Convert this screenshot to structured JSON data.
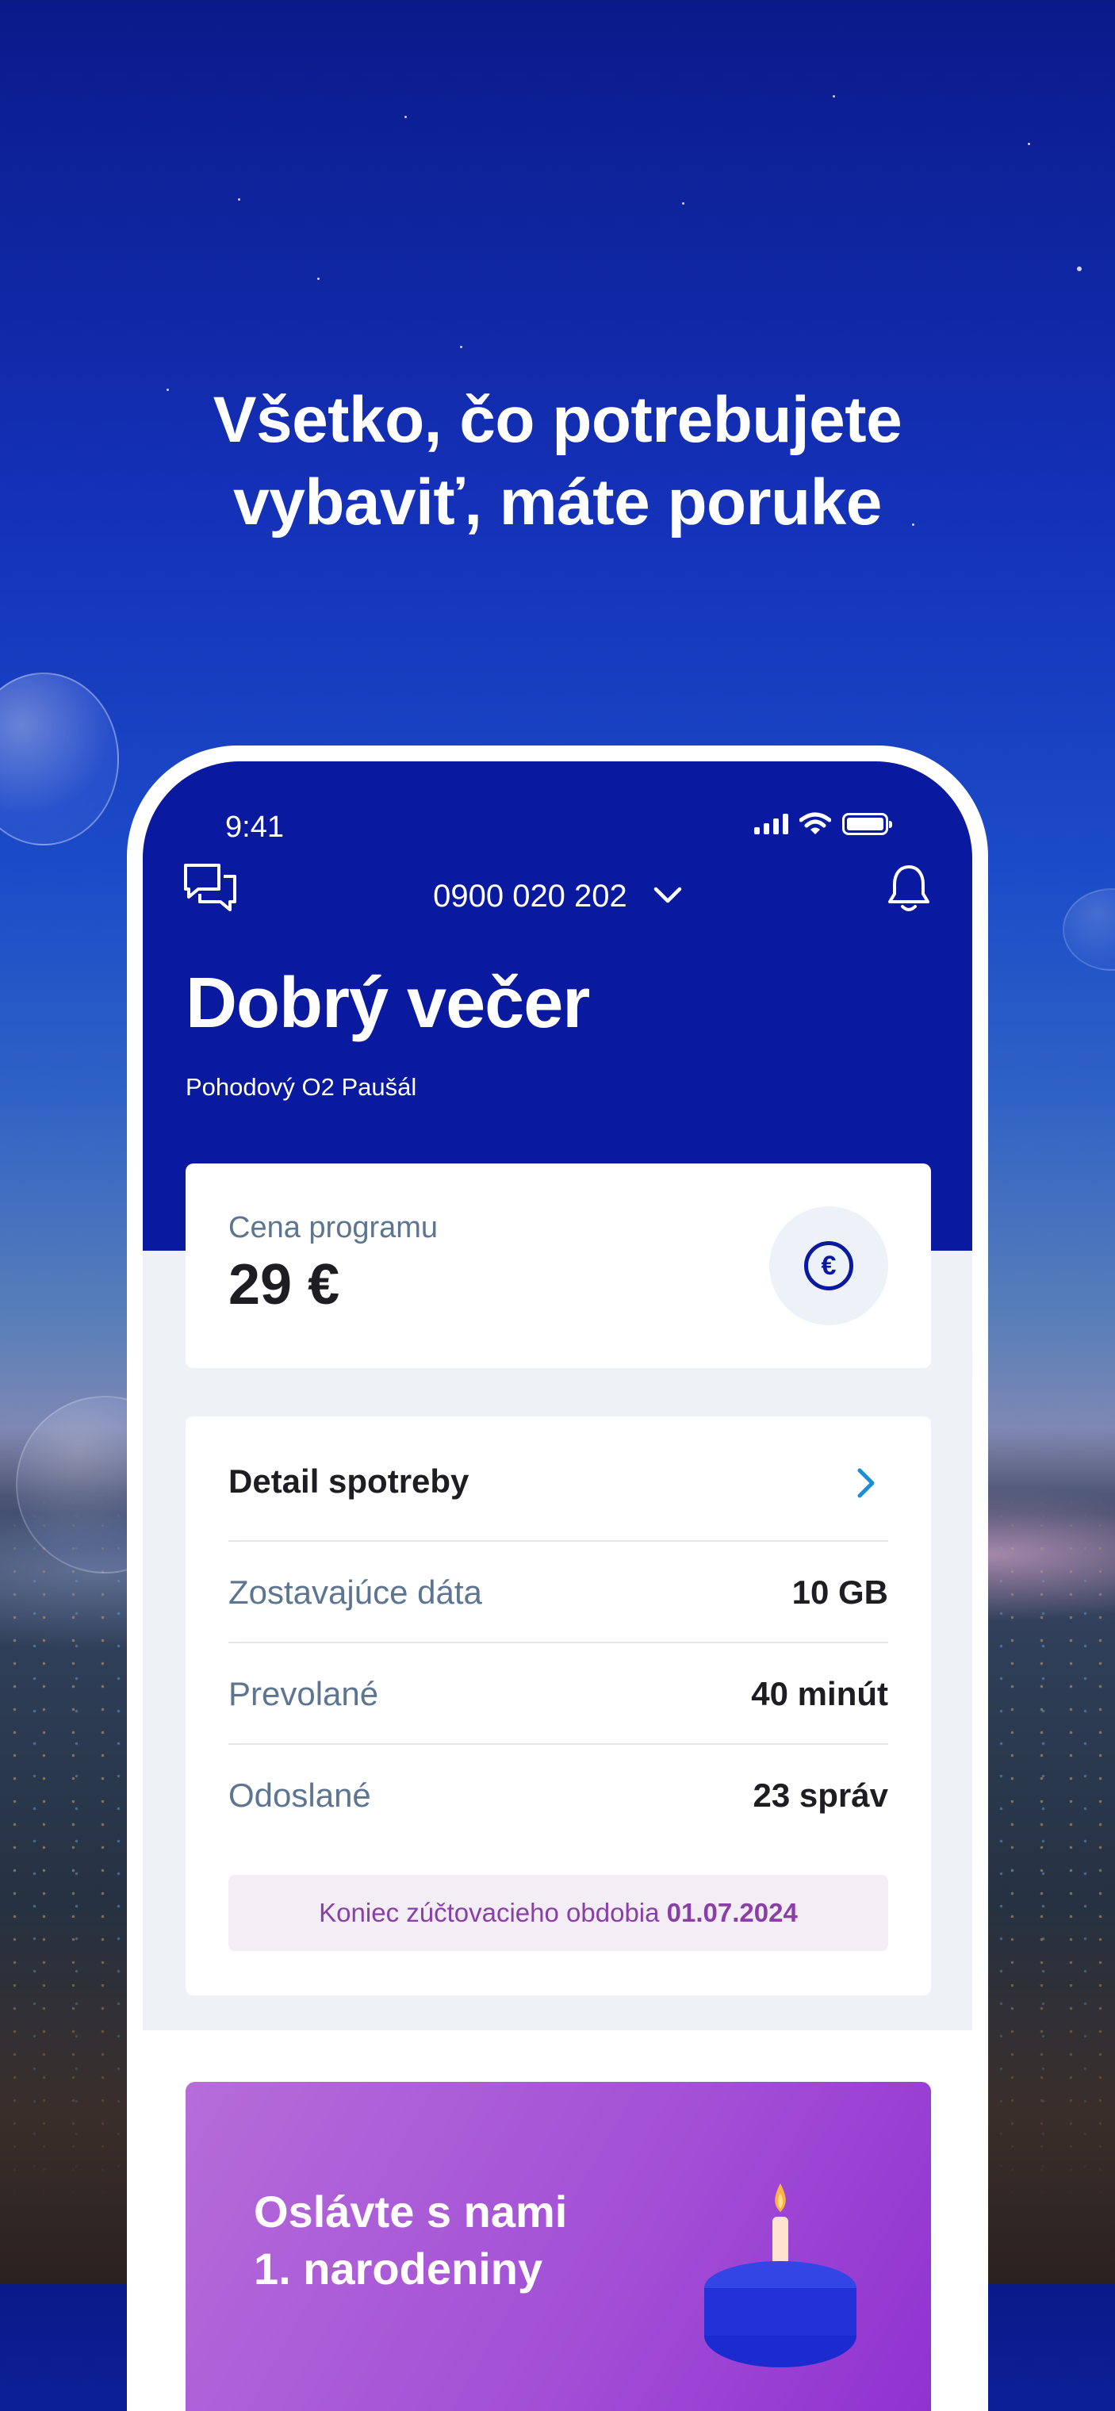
{
  "headline": {
    "line1": "Všetko, čo potrebujete",
    "line2": "vybaviť, máte poruke"
  },
  "status_bar": {
    "time": "9:41"
  },
  "header": {
    "phone_number": "0900 020 202",
    "greeting": "Dobrý večer",
    "plan_name": "Pohodový O2 Paušál"
  },
  "price_card": {
    "label": "Cena programu",
    "value": "29 €",
    "icon": "euro-icon"
  },
  "usage_card": {
    "title": "Detail spotreby",
    "rows": [
      {
        "label": "Zostavajúce dáta",
        "value": "10 GB"
      },
      {
        "label": "Prevolané",
        "value": "40 minút"
      },
      {
        "label": "Odoslané",
        "value": "23 správ"
      }
    ],
    "billing_label": "Koniec zúčtovacieho obdobia",
    "billing_date": "01.07.2024"
  },
  "promo": {
    "line1": "Oslávte s nami",
    "line2": "1. narodeniny"
  },
  "colors": {
    "brand_blue": "#0a1aa0",
    "accent_purple": "#8a3fa8",
    "link_blue": "#1a8fd6"
  }
}
